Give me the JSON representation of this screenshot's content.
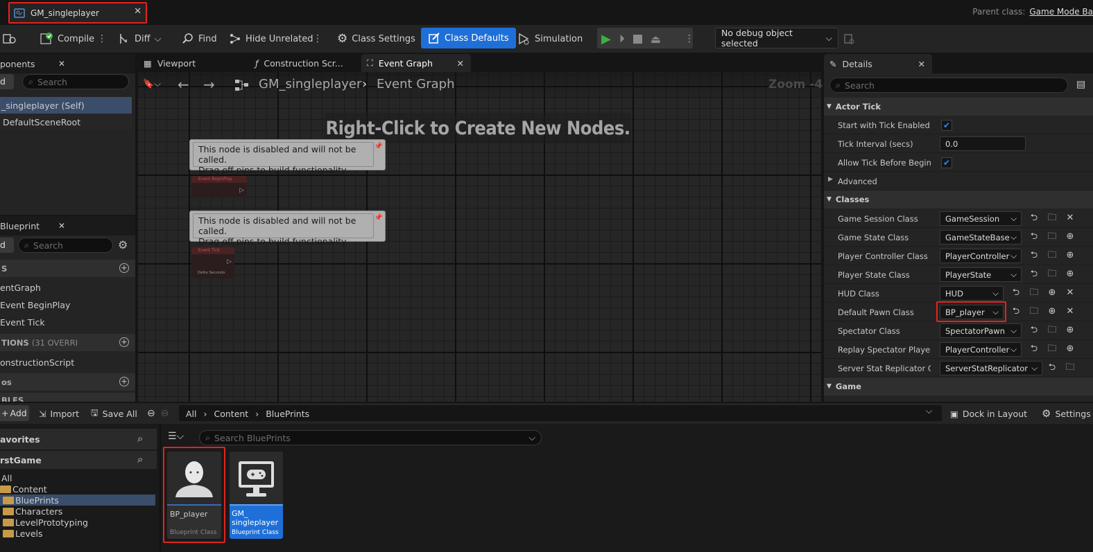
{
  "window": {
    "doc_tab_title": "GM_singleplayer",
    "parent_label": "Parent class:",
    "parent_value": "Game Mode Ba"
  },
  "toolbar": {
    "compile": "Compile",
    "diff": "Diff",
    "find": "Find",
    "hide_unrelated": "Hide Unrelated",
    "class_settings": "Class Settings",
    "class_defaults": "Class Defaults",
    "simulation": "Simulation",
    "debug_object": "No debug object selected"
  },
  "components": {
    "tab_title": "ponents",
    "add_fragment": "d",
    "search_placeholder": "Search",
    "items": [
      "_singleplayer (Self)",
      "DefaultSceneRoot"
    ]
  },
  "my_blueprint": {
    "tab_title": "Blueprint",
    "add_fragment": "d",
    "search_placeholder": "Search",
    "section_graphs": "S",
    "items": [
      "entGraph",
      "Event BeginPlay",
      "Event Tick"
    ],
    "section_functions": "TIONS",
    "functions_count": "(31 OVERRI",
    "function_items": [
      "onstructionScript"
    ],
    "section_macros": "os",
    "section_variables": "BLES"
  },
  "graph_tabs": {
    "viewport": "Viewport",
    "construction": "Construction Scr...",
    "event_graph": "Event Graph"
  },
  "graph": {
    "breadcrumb_root": "GM_singleplayer",
    "breadcrumb_child": "Event Graph",
    "zoom": "Zoom -4",
    "hint": "Right-Click to Create New Nodes.",
    "comment_line1": "This node is disabled and will not be called.",
    "comment_line2": "Drag off pins to build functionality.",
    "node1_title": "Event BeginPlay",
    "node2_title": "Event Tick",
    "node2_pin": "Delta Seconds"
  },
  "details": {
    "tab_title": "Details",
    "search_placeholder": "Search",
    "section_actor_tick": "Actor Tick",
    "start_tick_label": "Start with Tick Enabled",
    "tick_interval_label": "Tick Interval (secs)",
    "tick_interval_value": "0.0",
    "allow_tick_label": "Allow Tick Before Begin...",
    "advanced": "Advanced",
    "section_classes": "Classes",
    "classes": [
      {
        "label": "Game Session Class",
        "value": "GameSession"
      },
      {
        "label": "Game State Class",
        "value": "GameStateBase"
      },
      {
        "label": "Player Controller Class",
        "value": "PlayerController"
      },
      {
        "label": "Player State Class",
        "value": "PlayerState"
      },
      {
        "label": "HUD Class",
        "value": "HUD"
      },
      {
        "label": "Default Pawn Class",
        "value": "BP_player"
      },
      {
        "label": "Spectator Class",
        "value": "SpectatorPawn"
      },
      {
        "label": "Replay Spectator Player...",
        "value": "PlayerController"
      },
      {
        "label": "Server Stat Replicator Cl...",
        "value": "ServerStatReplicator"
      }
    ],
    "section_game": "Game"
  },
  "content_browser": {
    "add": "Add",
    "import": "Import",
    "save_all": "Save All",
    "path": [
      "All",
      "Content",
      "BluePrints"
    ],
    "dock_in_layout": "Dock in Layout",
    "settings": "Settings",
    "favorites": "avorites",
    "project": "rstGame",
    "tree": [
      "All",
      "Content",
      "BluePrints",
      "Characters",
      "LevelPrototyping",
      "Levels"
    ],
    "search_placeholder": "Search BluePrints",
    "assets": [
      {
        "name": "BP_player",
        "type": "Blueprint Class"
      },
      {
        "name": "GM_ singleplayer",
        "type": "Blueprint Class"
      }
    ]
  }
}
